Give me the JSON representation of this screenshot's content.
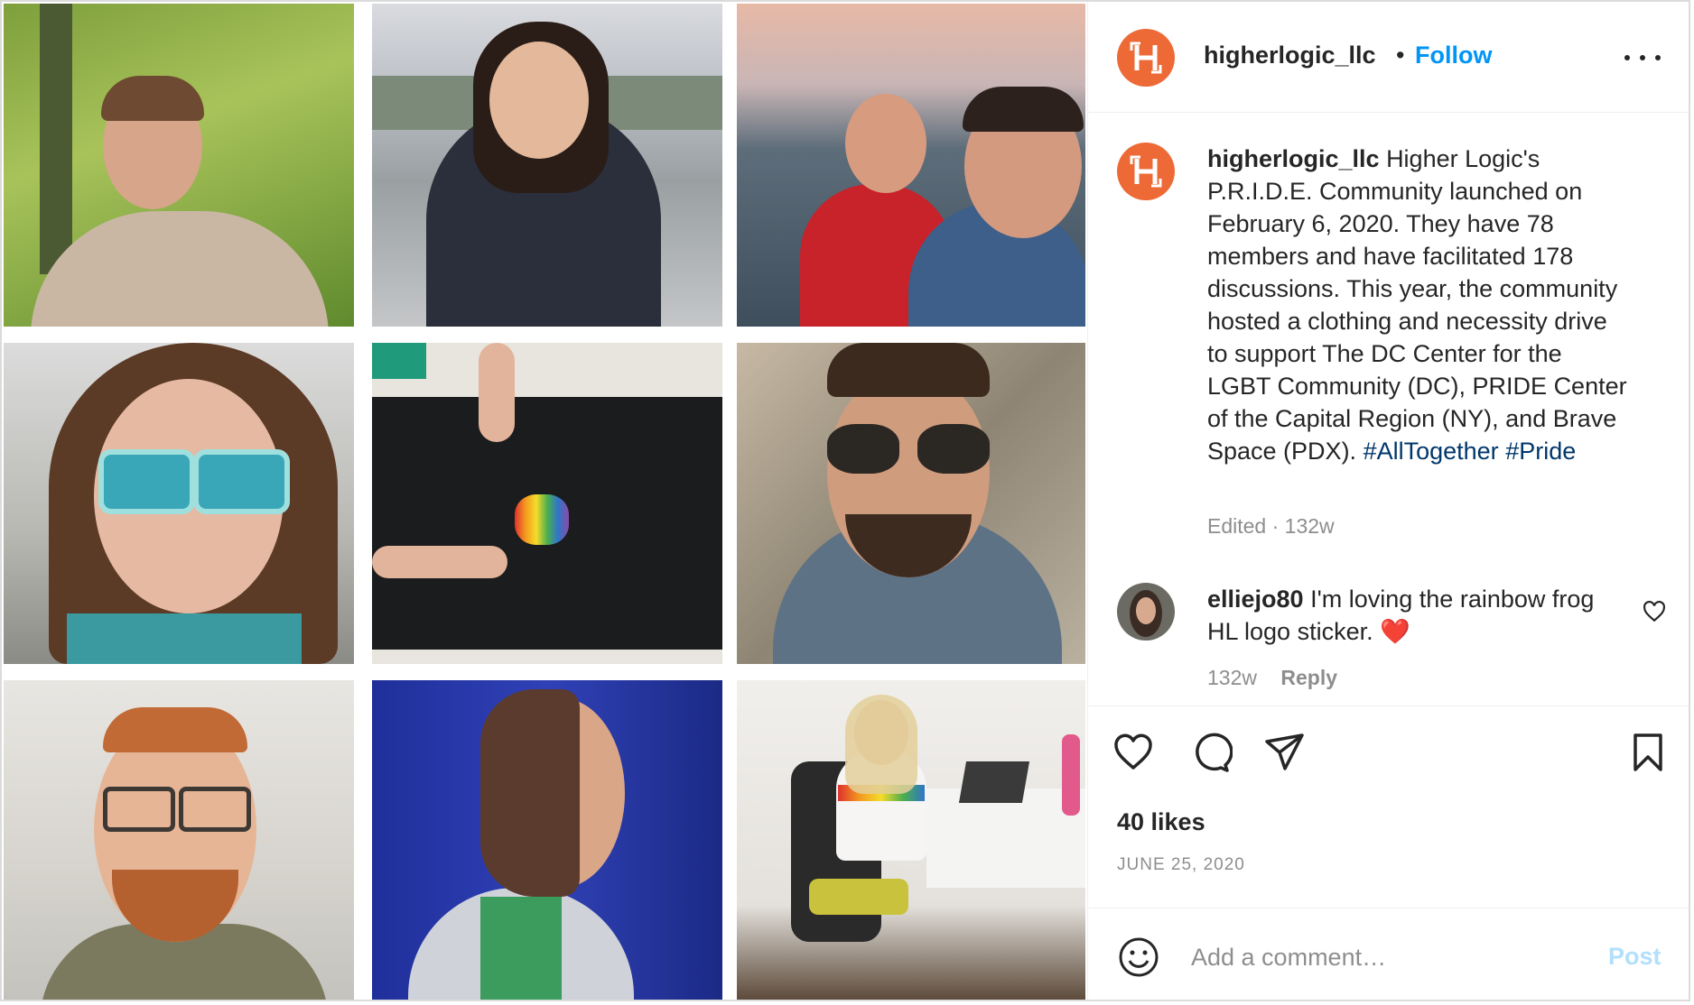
{
  "post": {
    "username": "higherlogic_llc",
    "follow_label": "Follow",
    "separator": "•",
    "brand_color": "#ed6a37",
    "logo_letter": "H"
  },
  "caption": {
    "username": "higherlogic_llc",
    "text": "Higher Logic's P.R.I.D.E. Community launched on February 6, 2020. They have 78 members and have facilitated 178 discussions. This year, the community hosted a clothing and necessity drive to support The DC Center for the LGBT Community (DC), PRIDE Center of the Capital Region (NY), and Brave Space (PDX).",
    "hashtags": [
      "#AllTogether",
      "#Pride"
    ],
    "meta": "Edited · 132w"
  },
  "comment": {
    "username": "elliejo80",
    "text": "I'm loving the rainbow frog HL logo sticker. ❤️",
    "age": "132w",
    "reply_label": "Reply"
  },
  "stats": {
    "likes": "40 likes",
    "date": "JUNE 25, 2020"
  },
  "add_comment": {
    "placeholder": "Add a comment…",
    "post_label": "Post"
  },
  "icons": [
    "more-icon",
    "heart-icon",
    "comment-icon",
    "share-icon",
    "bookmark-icon",
    "emoji-icon",
    "comment-like-icon"
  ]
}
